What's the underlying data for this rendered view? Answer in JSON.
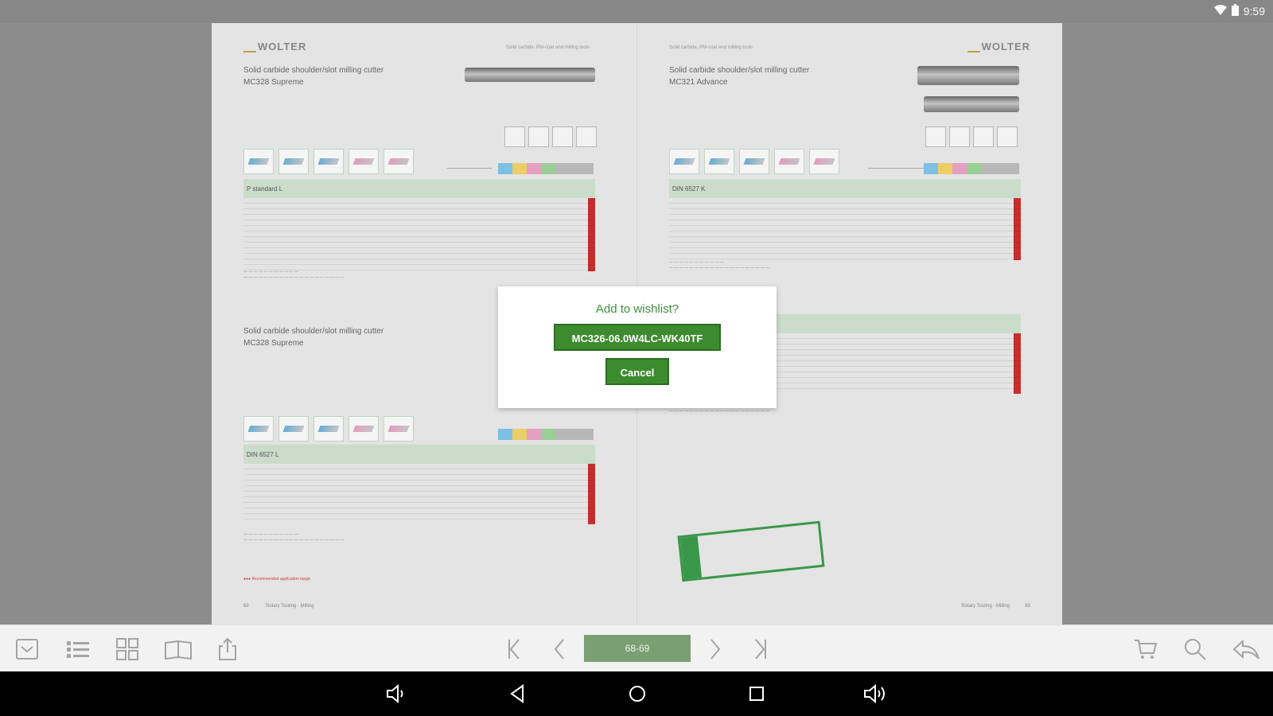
{
  "status_bar": {
    "time": "9:59",
    "wifi_icon": "wifi-icon",
    "signal_icon": "signal-icon"
  },
  "catalog": {
    "left_page": {
      "logo": "WOLTER",
      "header_text": "Solid carbide, PM-coat end milling tools",
      "section1_title_line1": "Solid carbide shoulder/slot milling cutter",
      "section1_title_line2": "MC328 Supreme",
      "section1_table_header": "P standard L",
      "section2_title_line1": "Solid carbide shoulder/slot milling cutter",
      "section2_title_line2": "MC328 Supreme",
      "section2_table_header": "DIN 6527 L",
      "legend": "●●● Recommended application range",
      "footer_left": "68",
      "footer_mid": "Rotary Tooling · Milling"
    },
    "right_page": {
      "logo": "WOLTER",
      "header_text": "Solid carbide, PM-coat end milling tools",
      "section1_title_line1": "Solid carbide shoulder/slot milling cutter",
      "section1_title_line2": "MC321 Advance",
      "section1_table_header": "DIN 6527 K",
      "footer_right": "Rotary Tooling · Milling",
      "footer_page": "69"
    }
  },
  "dialog": {
    "title": "Add to wishlist?",
    "item_button": "MC326-06.0W4LC-WK40TF",
    "cancel_button": "Cancel"
  },
  "toolbar": {
    "page_indicator": "68-69",
    "left_icons": [
      "inbox-icon",
      "list-icon",
      "grid-icon",
      "book-icon",
      "share-icon"
    ],
    "nav_icons": [
      "first-page-icon",
      "previous-page-icon",
      "next-page-icon",
      "last-page-icon"
    ],
    "right_icons": [
      "cart-icon",
      "search-icon",
      "back-arrow-icon"
    ]
  },
  "android_nav": [
    "volume-down-icon",
    "back-icon",
    "home-icon",
    "recents-icon",
    "volume-up-icon"
  ]
}
